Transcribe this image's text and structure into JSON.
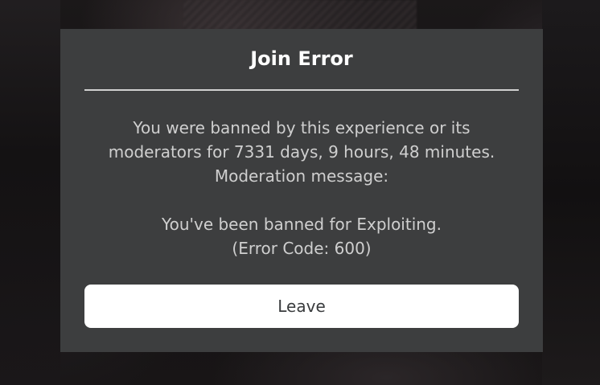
{
  "dialog": {
    "title": "Join Error",
    "message_lines": [
      "You were banned by this experience or its",
      "moderators for 7331 days, 9 hours, 48 minutes.",
      "Moderation message:"
    ],
    "reason": "You've been banned for Exploiting.",
    "error_code": "(Error Code: 600)",
    "leave_label": "Leave"
  },
  "colors": {
    "dialog_background": "#3d3e3f",
    "title_text": "#ffffff",
    "body_text": "#cfcfcf",
    "button_background": "#ffffff",
    "button_text": "#393b3d"
  }
}
